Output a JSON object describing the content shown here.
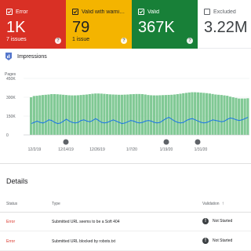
{
  "summary": {
    "error": {
      "label": "Error",
      "value": "1K",
      "sub": "7 issues",
      "color": "#d93025"
    },
    "warning": {
      "label": "Valid with warni…",
      "value": "79",
      "sub": "1 issue",
      "color": "#f4b400"
    },
    "valid": {
      "label": "Valid",
      "value": "367K",
      "color": "#188038"
    },
    "excluded": {
      "label": "Excluded",
      "value": "3.22M"
    }
  },
  "impressions": {
    "label": "Impressions",
    "icon": "chart-icon"
  },
  "chart_data": {
    "type": "bar",
    "ylabel": "Pages",
    "yticks": [
      "450K",
      "300K",
      "150K",
      "0"
    ],
    "ylim": [
      0,
      450000
    ],
    "xticks": [
      "12/2/19",
      "12/14/19",
      "12/26/19",
      "1/7/20",
      "1/19/20",
      "1/31/20"
    ],
    "series": [
      {
        "values": [
          300000,
          310000,
          312000,
          315000,
          318000,
          320000,
          322000,
          325000,
          325000,
          324000,
          322000,
          320000,
          318000,
          316000,
          315000,
          315000,
          316000,
          318000,
          320000,
          322000,
          325000,
          328000,
          330000,
          330000,
          329000,
          327000,
          325000,
          323000,
          322000,
          321000,
          320000,
          320000,
          321000,
          322000,
          324000,
          325000,
          326000,
          326000,
          325000,
          322000,
          318000,
          316000,
          315000,
          315000,
          316000,
          317000,
          318000,
          319000,
          320000,
          322000,
          325000,
          328000,
          332000,
          335000,
          338000,
          340000,
          340000,
          339000,
          337000,
          335000,
          333000,
          330000,
          326000,
          322000,
          320000,
          318000,
          315000,
          312000,
          305000,
          300000,
          295000,
          290000,
          290000,
          290000,
          292000
        ]
      },
      {
        "values": [
          90000,
          100000,
          110000,
          100000,
          95000,
          105000,
          120000,
          115000,
          100000,
          90000,
          95000,
          110000,
          125000,
          110000,
          100000,
          95000,
          100000,
          115000,
          120000,
          110000,
          105000,
          115000,
          130000,
          115000,
          100000,
          95000,
          100000,
          110000,
          120000,
          110000,
          100000,
          90000,
          95000,
          105000,
          115000,
          110000,
          100000,
          95000,
          100000,
          110000,
          115000,
          110000,
          100000,
          95000,
          100000,
          115000,
          130000,
          140000,
          125000,
          110000,
          100000,
          95000,
          100000,
          115000,
          125000,
          130000,
          120000,
          110000,
          100000,
          95000,
          100000,
          110000,
          120000,
          115000,
          110000,
          105000,
          110000,
          125000,
          135000,
          130000,
          120000,
          115000,
          120000,
          130000,
          140000
        ]
      }
    ]
  },
  "details": {
    "title": "Details",
    "columns": {
      "status": "Status",
      "type": "Type",
      "validation": "Validation"
    },
    "rows": [
      {
        "status": "Error",
        "type": "Submitted URL seems to be a Soft 404",
        "validation": "Not Started"
      },
      {
        "status": "Error",
        "type": "Submitted URL blocked by robots.txt",
        "validation": "Not Started"
      }
    ]
  }
}
